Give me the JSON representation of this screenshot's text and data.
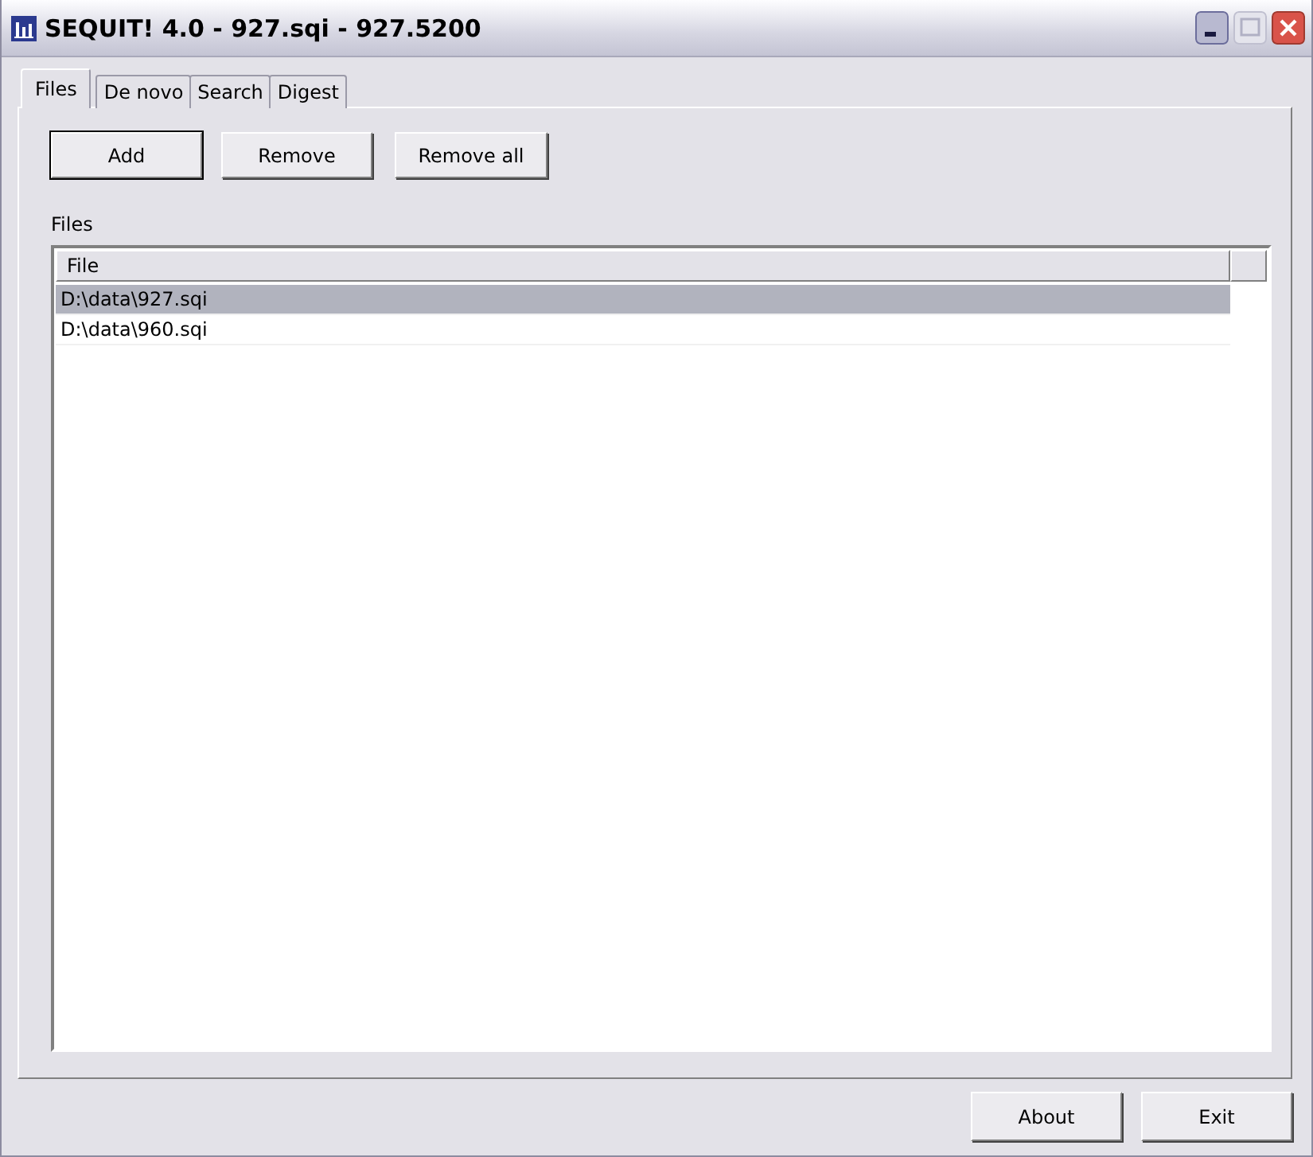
{
  "window": {
    "title": "SEQUIT! 4.0 - 927.sqi - 927.5200"
  },
  "tabs": [
    {
      "label": "Files",
      "selected": true
    },
    {
      "label": "De novo",
      "selected": false
    },
    {
      "label": "Search",
      "selected": false
    },
    {
      "label": "Digest",
      "selected": false
    }
  ],
  "toolbar_buttons": [
    {
      "label": "Add",
      "default": true
    },
    {
      "label": "Remove",
      "default": false
    },
    {
      "label": "Remove all",
      "default": false
    }
  ],
  "list_label": "Files",
  "table": {
    "columns": [
      "File"
    ],
    "rows": [
      {
        "file": "D:\\data\\927.sqi",
        "selected": true
      },
      {
        "file": "D:\\data\\960.sqi",
        "selected": false
      }
    ]
  },
  "footer_buttons": [
    "About",
    "Exit"
  ]
}
